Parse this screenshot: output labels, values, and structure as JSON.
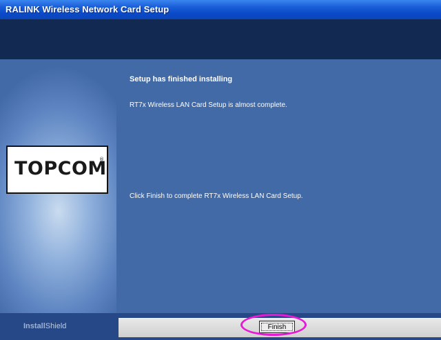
{
  "window": {
    "title": "RALINK Wireless Network Card Setup"
  },
  "sidebar": {
    "logo_text": "TOPCOM",
    "logo_mark": "®"
  },
  "main": {
    "heading": "Setup has finished installing",
    "message_complete": "RT7x Wireless LAN Card Setup is almost complete.",
    "message_instruction": "Click Finish to complete RT7x Wireless LAN Card Setup."
  },
  "footer": {
    "brand_bold": "Install",
    "brand_thin": "Shield",
    "finish_label": "Finish"
  },
  "colors": {
    "titlebar": "#0a49c9",
    "header_band": "#122a52",
    "content_bg": "#426aa7",
    "highlight_ring": "#e61ad4"
  }
}
